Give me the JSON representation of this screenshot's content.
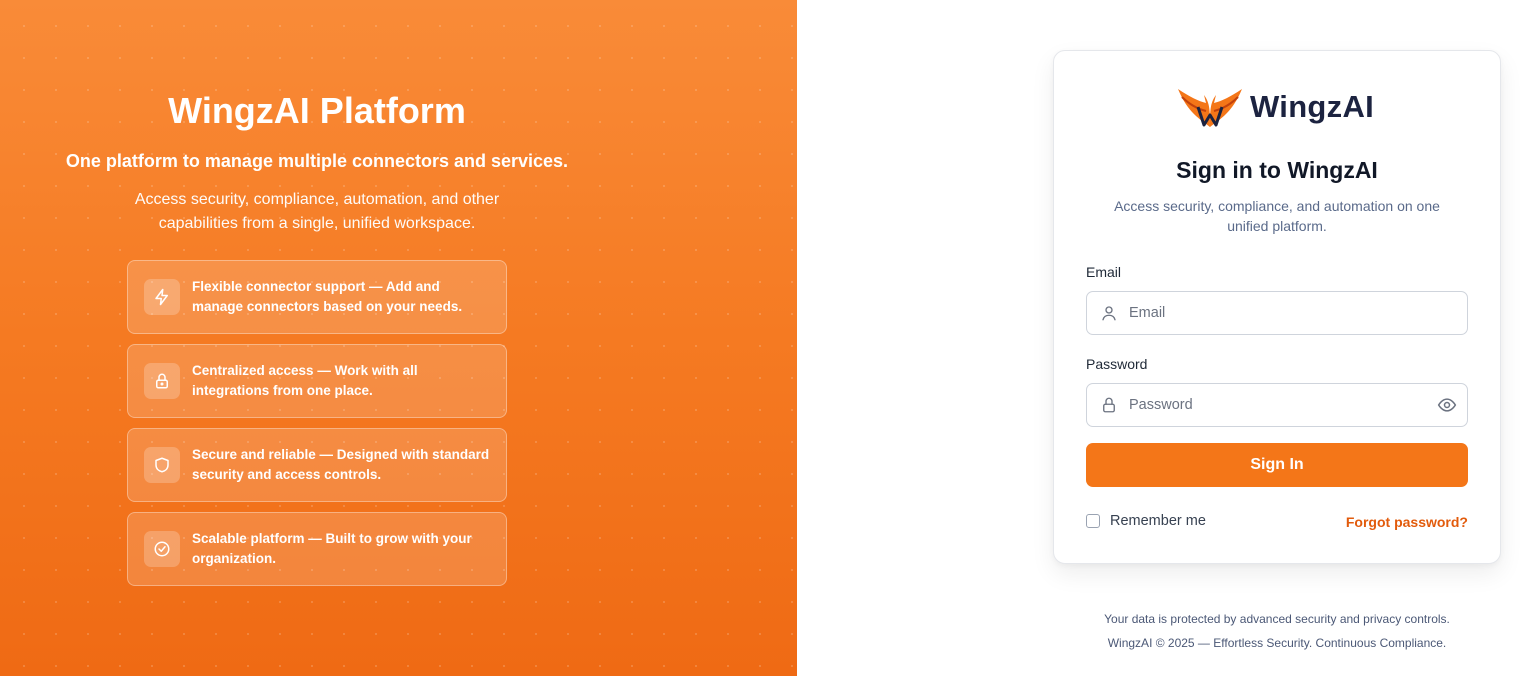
{
  "hero": {
    "title": "WingzAI Platform",
    "subtitle": "One platform to manage multiple connectors and services.",
    "description": "Access security, compliance, automation, and other capabilities from a single, unified workspace.",
    "features": [
      {
        "icon": "lightning-icon",
        "text": "Flexible connector support — Add and manage connectors based on your needs."
      },
      {
        "icon": "lock-icon",
        "text": "Centralized access — Work with all integrations from one place."
      },
      {
        "icon": "shield-icon",
        "text": "Secure and reliable — Designed with standard security and access controls."
      },
      {
        "icon": "check-circle-icon",
        "text": "Scalable platform — Built to grow with your organization."
      }
    ]
  },
  "colors": {
    "accent": "#f47618",
    "link": "#e25b0c",
    "brand_dark": "#1c2340"
  },
  "card": {
    "logo_text": "WingzAI",
    "title": "Sign in to WingzAI",
    "subtitle": "Access security, compliance, and automation on one unified platform.",
    "email_label": "Email",
    "email_placeholder": "Email",
    "password_label": "Password",
    "password_placeholder": "Password",
    "sign_in_label": "Sign In",
    "remember_label": "Remember me",
    "forgot_label": "Forgot password?"
  },
  "footer": {
    "line1": "Your data is protected by advanced security and privacy controls.",
    "line2": "WingzAI © 2025 — Effortless Security. Continuous Compliance."
  }
}
